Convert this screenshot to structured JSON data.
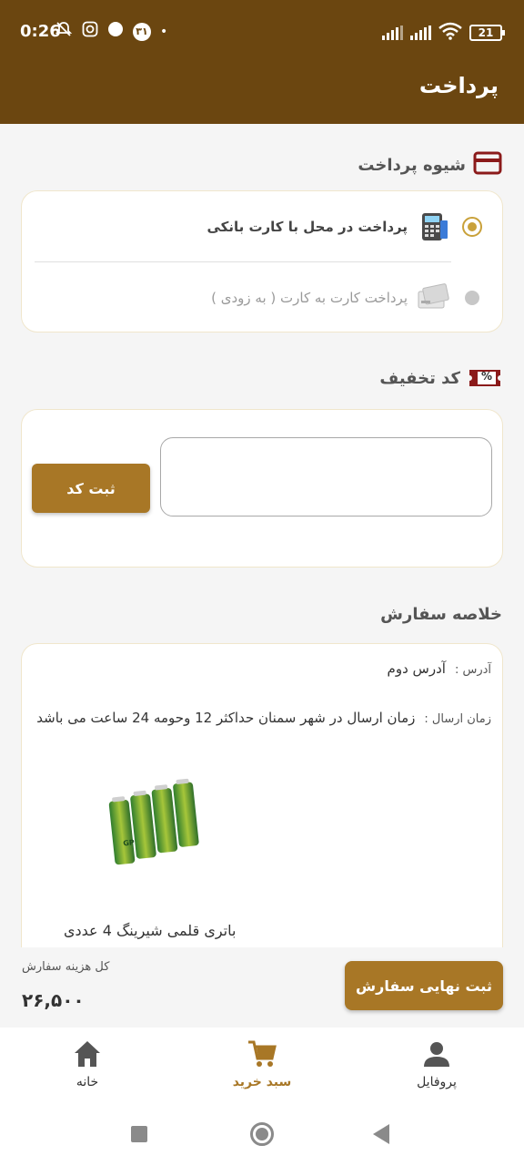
{
  "status_bar": {
    "time": "0:26",
    "calendar_badge": "۳۱",
    "battery": "21"
  },
  "header": {
    "title": "پرداخت"
  },
  "payment_method": {
    "title": "شیوه پرداخت",
    "options": [
      {
        "label": "پرداخت در محل با کارت بانکی",
        "selected": true
      },
      {
        "label": "پرداخت کارت به کارت ( به زودی )",
        "selected": false
      }
    ]
  },
  "discount": {
    "title": "کد تخفیف",
    "badge": "%",
    "input_value": "",
    "submit_label": "ثبت کد"
  },
  "summary": {
    "title": "خلاصه سفارش",
    "address_key": "آدرس :",
    "address_value": "آدرس دوم",
    "delivery_key": "زمان ارسال :",
    "delivery_value": "زمان ارسال در شهر سمنان حداکثر 12 وحومه 24 ساعت می باشد",
    "product_name": "باتری قلمی شیرینگ 4 عددی",
    "battery_brand": "GP"
  },
  "total": {
    "label": "کل هزینه سفارش",
    "value": "۲۶,۵۰۰"
  },
  "final_submit_label": "ثبت نهایی سفارش",
  "bottom_nav": [
    {
      "label": "پروفایل",
      "icon": "person-icon",
      "active": false
    },
    {
      "label": "سبد خرید",
      "icon": "cart-icon",
      "active": true
    },
    {
      "label": "خانه",
      "icon": "home-icon",
      "active": false
    }
  ],
  "colors": {
    "header": "#6b4610",
    "accent": "#a87726",
    "radio": "#c9a13a"
  }
}
